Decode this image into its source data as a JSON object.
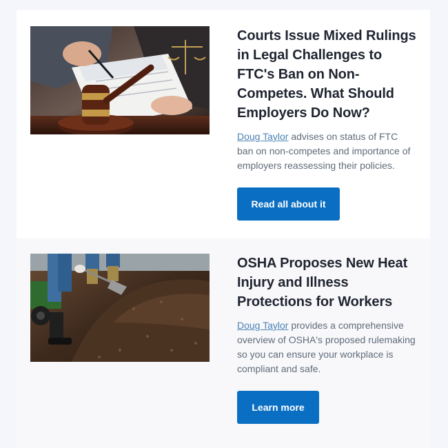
{
  "articles": [
    {
      "title": "Courts Issue Mixed Rulings in Legal Challenges to FTC's Ban on Non-Competes. What Should Employers Do Now?",
      "author": "Doug Taylor",
      "description": " advises on status of FTC ban on non-competes and importance of employers reassessing their policies.",
      "button_label": "Read all about it",
      "image": "gavel-and-contract-photo"
    },
    {
      "title": "OSHA Proposes New Heat Injury and Illness Protections for Workers",
      "author": "Doug Taylor",
      "description": " provides a comprehensive overview of OSHA's proposed rulemaking so you can ensure your workplace is compliant and safe.",
      "button_label": "Learn more",
      "image": "workers-shoveling-mulch-photo"
    }
  ],
  "colors": {
    "button": "#0a6fc2",
    "link": "#4a82b5",
    "title": "#1f2430",
    "text": "#5f6b7a"
  }
}
